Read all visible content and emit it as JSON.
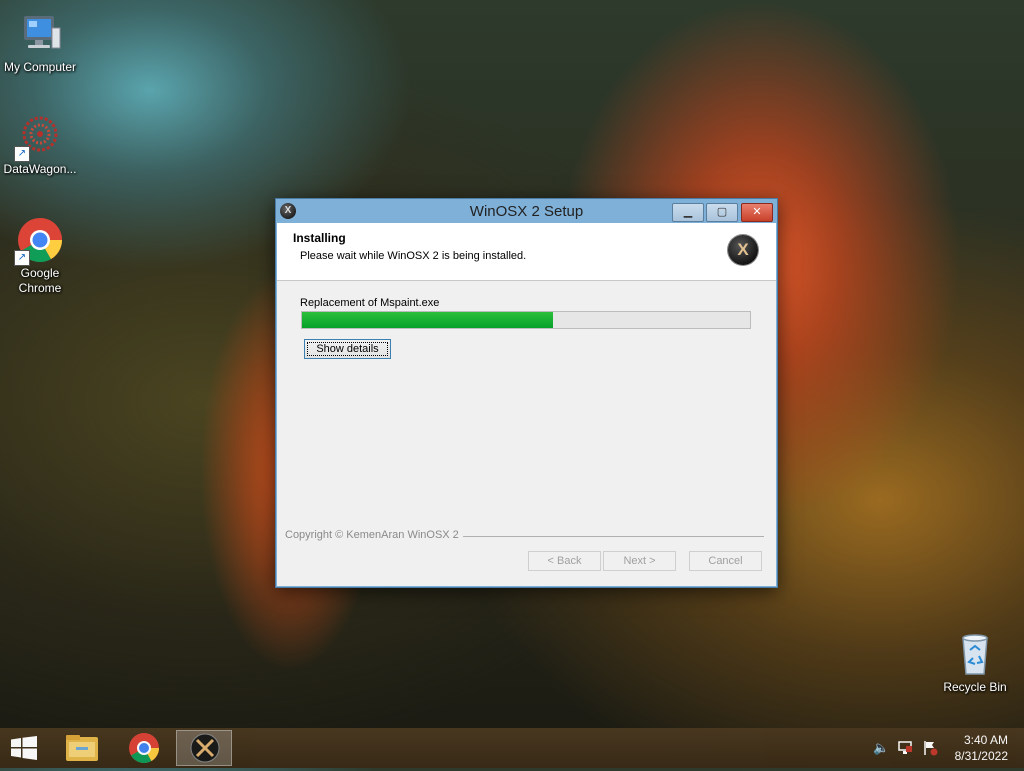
{
  "desktop": {
    "icons": [
      {
        "label": "My Computer",
        "icon": "computer-icon"
      },
      {
        "label": "DataWagon...",
        "icon": "datawagon-icon"
      },
      {
        "label": "Google Chrome",
        "icon": "chrome-icon"
      },
      {
        "label": "Recycle Bin",
        "icon": "recycle-bin-icon"
      }
    ]
  },
  "window": {
    "title": "WinOSX 2 Setup",
    "header_title": "Installing",
    "header_subtitle": "Please wait while WinOSX 2 is being installed.",
    "logo_glyph": "X",
    "status_text": "Replacement of Mspaint.exe",
    "progress": 0.56,
    "show_details_label": "Show details",
    "copyright": "Copyright © KemenAran WinOSX 2",
    "back_label": "< Back",
    "next_label": "Next >",
    "cancel_label": "Cancel"
  },
  "taskbar": {
    "apps": [
      "file-explorer-icon",
      "chrome-icon",
      "winosx-setup-icon"
    ],
    "active_app": "winosx-setup-icon",
    "tray_icons": [
      "speaker-muted-icon",
      "network-icon",
      "action-center-flag-icon"
    ],
    "time": "3:40 AM",
    "date": "8/31/2022"
  },
  "colors": {
    "progress_fill": "#06a12a",
    "title_bar": "#7fb0d8"
  }
}
